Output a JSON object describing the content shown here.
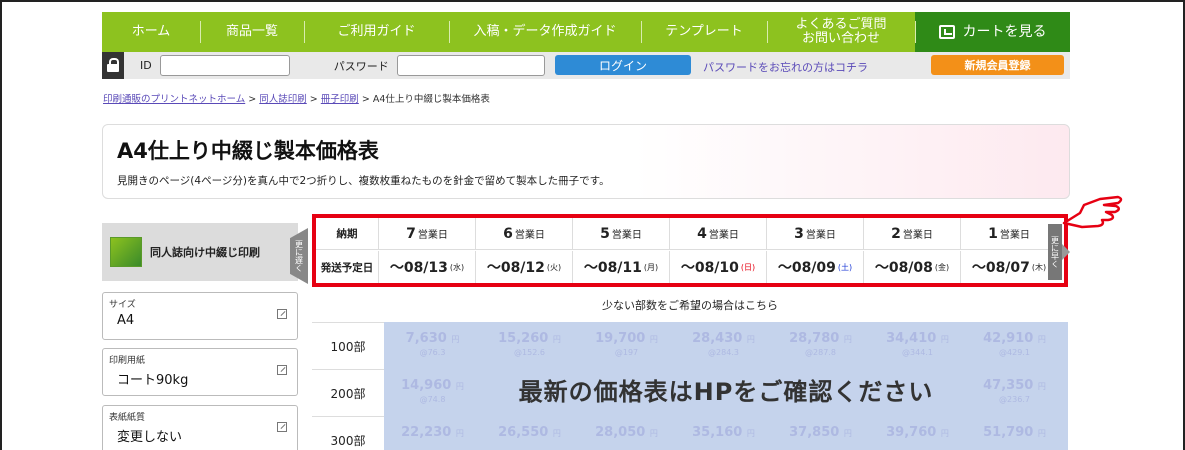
{
  "nav": {
    "items": [
      "ホーム",
      "商品一覧",
      "ご利用ガイド",
      "入稿・データ作成ガイド",
      "テンプレート",
      "よくあるご質問\nお問い合わせ"
    ],
    "cart": "カートを見る"
  },
  "login": {
    "id_label": "ID",
    "password_label": "パスワード",
    "login_button": "ログイン",
    "forgot_link": "パスワードをお忘れの方はコチラ",
    "register_button": "新規会員登録"
  },
  "breadcrumb": {
    "home": "印刷通販のプリントネットホーム",
    "sep": ">",
    "level2": "同人誌印刷",
    "level3": "冊子印刷",
    "current": "A4仕上り中綴じ製本価格表"
  },
  "page": {
    "title": "A4仕上り中綴じ製本価格表",
    "description": "見開きのページ(4ページ分)を真ん中で2つ折りし、複数枚重ねたものを針金で留めて製本した冊子です。"
  },
  "sidebar": {
    "header": "同人誌向け中綴じ印刷",
    "fields": [
      {
        "label": "サイズ",
        "value": "A4"
      },
      {
        "label": "印刷用紙",
        "value": "コート90kg"
      },
      {
        "label": "表紙紙質",
        "value": "変更しない"
      }
    ]
  },
  "delivery": {
    "left_toggle": "更に遅く",
    "right_toggle": "更に早く",
    "lead_label": "納期",
    "ship_label": "発送予定日",
    "unit": "営業日",
    "days": [
      {
        "n": "7",
        "date": "～08/13",
        "dow": "(水)",
        "type": "weekday"
      },
      {
        "n": "6",
        "date": "～08/12",
        "dow": "(火)",
        "type": "weekday"
      },
      {
        "n": "5",
        "date": "～08/11",
        "dow": "(月)",
        "type": "weekday"
      },
      {
        "n": "4",
        "date": "～08/10",
        "dow": "(日)",
        "type": "sun"
      },
      {
        "n": "3",
        "date": "～08/09",
        "dow": "(土)",
        "type": "sat"
      },
      {
        "n": "2",
        "date": "～08/08",
        "dow": "(金)",
        "type": "weekday"
      },
      {
        "n": "1",
        "date": "～08/07",
        "dow": "(木)",
        "type": "weekday"
      }
    ],
    "small_order_text": "少ない部数をご希望の場合はこちら"
  },
  "prices": {
    "quantities": [
      "100部",
      "200部",
      "300部"
    ],
    "rows": [
      [
        {
          "v": "7,630",
          "s": "@76.3"
        },
        {
          "v": "15,260",
          "s": "@152.6"
        },
        {
          "v": "19,700",
          "s": "@197"
        },
        {
          "v": "28,430",
          "s": "@284.3"
        },
        {
          "v": "28,780",
          "s": "@287.8"
        },
        {
          "v": "34,410",
          "s": "@344.1"
        },
        {
          "v": "42,910",
          "s": "@429.1"
        }
      ],
      [
        {
          "v": "14,960",
          "s": "@74.8"
        },
        {
          "v": "",
          "s": ""
        },
        {
          "v": "",
          "s": ""
        },
        {
          "v": "",
          "s": ""
        },
        {
          "v": "",
          "s": ""
        },
        {
          "v": "",
          "s": ""
        },
        {
          "v": "47,350",
          "s": "@236.7"
        }
      ],
      [
        {
          "v": "22,230",
          "s": ""
        },
        {
          "v": "26,550",
          "s": ""
        },
        {
          "v": "28,050",
          "s": ""
        },
        {
          "v": "35,160",
          "s": ""
        },
        {
          "v": "37,850",
          "s": ""
        },
        {
          "v": "39,760",
          "s": ""
        },
        {
          "v": "51,790",
          "s": ""
        }
      ]
    ],
    "yen": "円",
    "overlay": "最新の価格表はHPをご確認ください"
  }
}
